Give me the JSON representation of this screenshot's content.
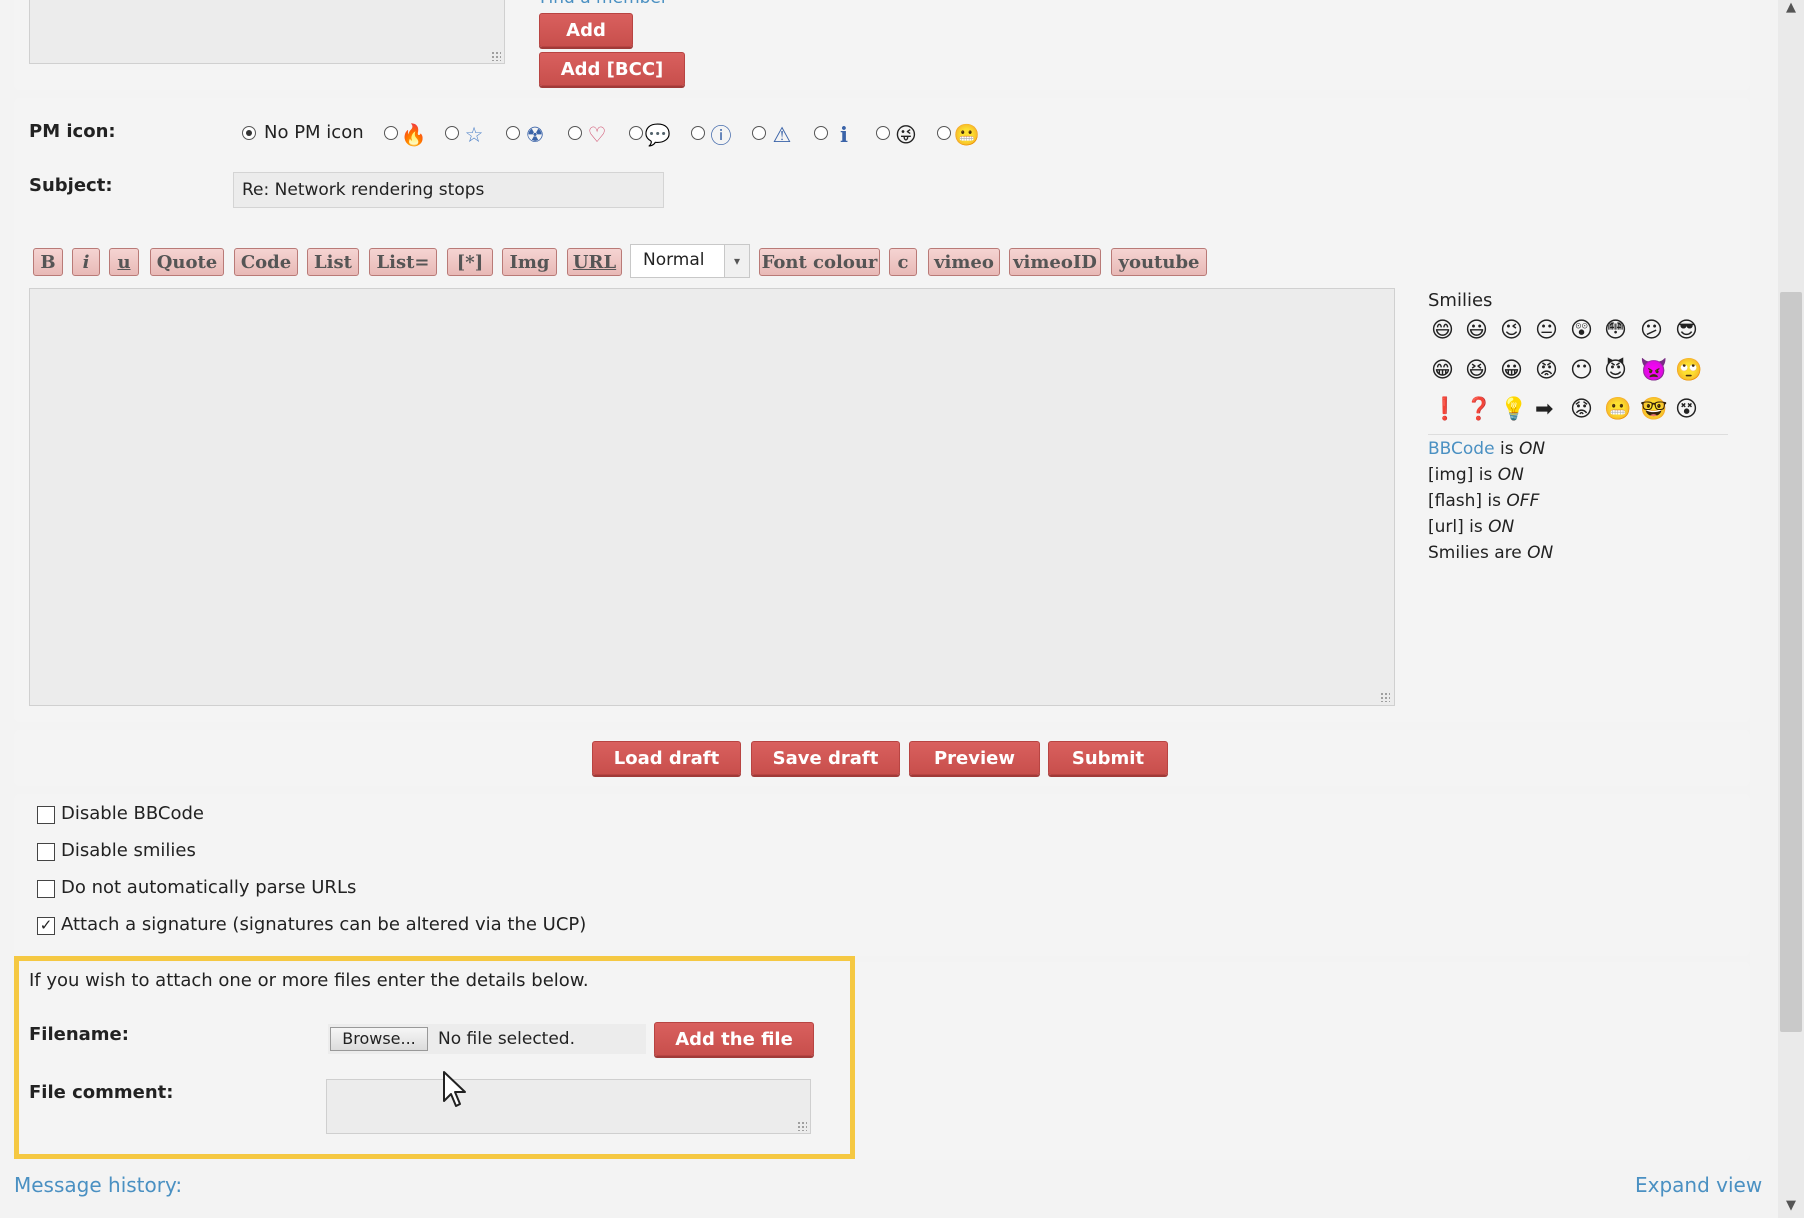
{
  "recipients": {
    "find_member_label": "Find a member",
    "add_label": "Add",
    "add_bcc_label": "Add [BCC]"
  },
  "pm_icon": {
    "label": "PM icon:",
    "none_label": "No PM icon",
    "options": [
      "fire-icon",
      "star-icon",
      "radioactive-icon",
      "heart-icon",
      "speech-bubble-icon",
      "question-icon",
      "warning-icon",
      "info-icon",
      "wink-smiley-icon",
      "grin-smiley-icon"
    ]
  },
  "subject": {
    "label": "Subject:",
    "value": "Re: Network rendering stops"
  },
  "toolbar": {
    "bold": "B",
    "italic": "i",
    "underline": "u",
    "quote": "Quote",
    "code": "Code",
    "list": "List",
    "list_eq": "List=",
    "list_item": "[*]",
    "img": "Img",
    "url": "URL",
    "font_size": "Normal",
    "font_colour": "Font colour",
    "c": "c",
    "vimeo": "vimeo",
    "vimeoid": "vimeoID",
    "youtube": "youtube"
  },
  "smilies": {
    "title": "Smilies",
    "rows": [
      [
        "😄",
        "😃",
        "😉",
        "😐",
        "😲",
        "😳",
        "😕",
        "😎"
      ],
      [
        "😁",
        "😆",
        "😀",
        "😡",
        "😶",
        "😈",
        "👿",
        "🙄"
      ],
      [
        "❗",
        "❓",
        "💡",
        "➡",
        "😟",
        "😬",
        "🤓",
        "😵"
      ]
    ]
  },
  "status": {
    "bbcode_link": "BBCode",
    "bbcode_is": "is",
    "bbcode_state": "ON",
    "img_text": "[img] is",
    "img_state": "ON",
    "flash_text": "[flash] is",
    "flash_state": "OFF",
    "url_text": "[url] is",
    "url_state": "ON",
    "smilies_text": "Smilies are",
    "smilies_state": "ON"
  },
  "actions": {
    "load_draft": "Load draft",
    "save_draft": "Save draft",
    "preview": "Preview",
    "submit": "Submit"
  },
  "options": {
    "disable_bbcode": "Disable BBCode",
    "disable_smilies": "Disable smilies",
    "no_parse_urls": "Do not automatically parse URLs",
    "attach_signature": "Attach a signature (signatures can be altered via the UCP)",
    "attach_signature_checked": true
  },
  "attachments": {
    "intro": "If you wish to attach one or more files enter the details below.",
    "filename_label": "Filename:",
    "browse_label": "Browse...",
    "no_file": "No file selected.",
    "add_file_label": "Add the file",
    "file_comment_label": "File comment:"
  },
  "footer": {
    "message_history": "Message history:",
    "expand_view": "Expand view"
  },
  "colors": {
    "accent_red": "#cf5552",
    "highlight_yellow": "#f5c842",
    "link_blue": "#4a90c2"
  }
}
